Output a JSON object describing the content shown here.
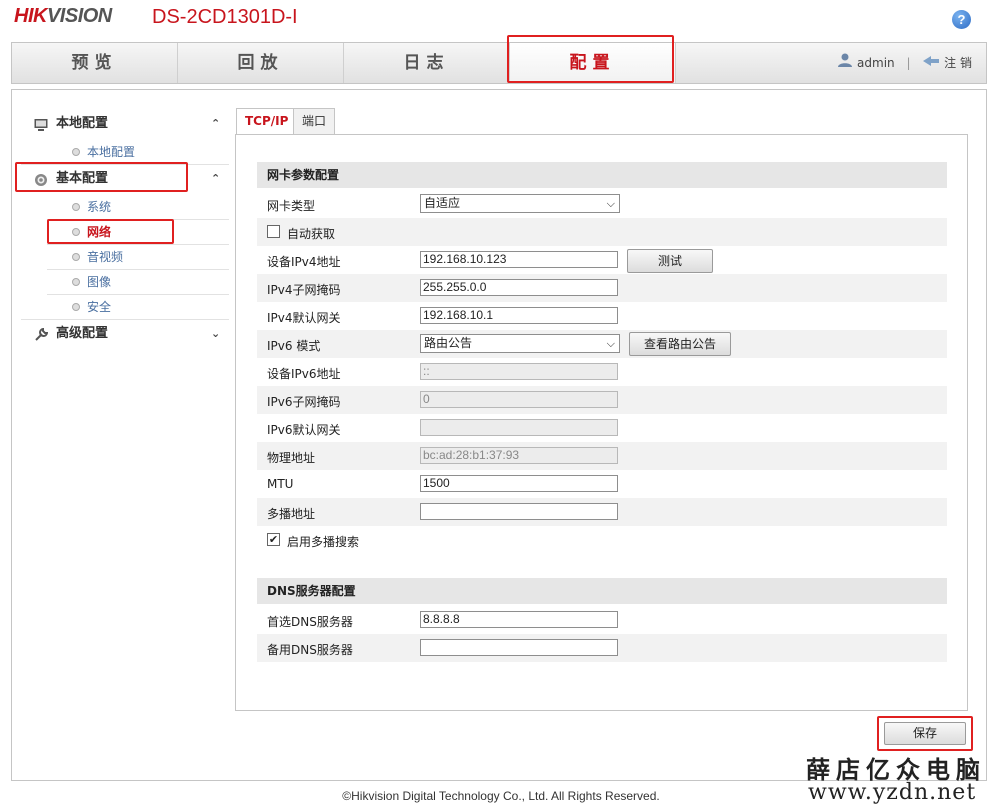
{
  "header": {
    "brand_part1": "HIK",
    "brand_part2": "VISION",
    "model": "DS-2CD1301D-I",
    "help_label": "?"
  },
  "nav": {
    "tabs": [
      {
        "label": "预览"
      },
      {
        "label": "回放"
      },
      {
        "label": "日志"
      },
      {
        "label": "配置",
        "active": true
      }
    ],
    "user": "admin",
    "separator": "|",
    "logout": "注 销"
  },
  "sidebar": {
    "groups": [
      {
        "label": "本地配置",
        "icon": "monitor-icon",
        "expanded": true,
        "items": [
          {
            "label": "本地配置"
          }
        ]
      },
      {
        "label": "基本配置",
        "icon": "gear-icon",
        "expanded": true,
        "items": [
          {
            "label": "系统"
          },
          {
            "label": "网络",
            "active": true
          },
          {
            "label": "音视频"
          },
          {
            "label": "图像"
          },
          {
            "label": "安全"
          }
        ]
      },
      {
        "label": "高级配置",
        "icon": "wrench-icon",
        "expanded": false
      }
    ]
  },
  "tabs": [
    {
      "label": "TCP/IP",
      "active": true
    },
    {
      "label": "端口"
    }
  ],
  "nic": {
    "section_title": "网卡参数配置",
    "nic_type_label": "网卡类型",
    "nic_type_value": "自适应",
    "dhcp_label": "自动获取",
    "dhcp_checked": false,
    "ipv4_addr_label": "设备IPv4地址",
    "ipv4_addr": "192.168.10.123",
    "test_button": "测试",
    "ipv4_mask_label": "IPv4子网掩码",
    "ipv4_mask": "255.255.0.0",
    "ipv4_gw_label": "IPv4默认网关",
    "ipv4_gw": "192.168.10.1",
    "ipv6_mode_label": "IPv6 模式",
    "ipv6_mode": "路由公告",
    "view_route_button": "查看路由公告",
    "ipv6_addr_label": "设备IPv6地址",
    "ipv6_addr": "::",
    "ipv6_mask_label": "IPv6子网掩码",
    "ipv6_mask": "0",
    "ipv6_gw_label": "IPv6默认网关",
    "ipv6_gw": "",
    "mac_label": "物理地址",
    "mac": "bc:ad:28:b1:37:93",
    "mtu_label": "MTU",
    "mtu": "1500",
    "multicast_label": "多播地址",
    "multicast": "",
    "multicast_search_label": "启用多播搜索",
    "multicast_search_checked": true
  },
  "dns": {
    "section_title": "DNS服务器配置",
    "primary_label": "首选DNS服务器",
    "primary": "8.8.8.8",
    "secondary_label": "备用DNS服务器",
    "secondary": ""
  },
  "save_button": "保存",
  "footer": "©Hikvision Digital Technology Co., Ltd. All Rights Reserved.",
  "watermark": {
    "line1": "薛店亿众电脑",
    "line2": "www.yzdn.net"
  },
  "colors": {
    "brand_red": "#c8151d",
    "highlight_box": "#e02020",
    "link_blue": "#4a6fa0"
  }
}
